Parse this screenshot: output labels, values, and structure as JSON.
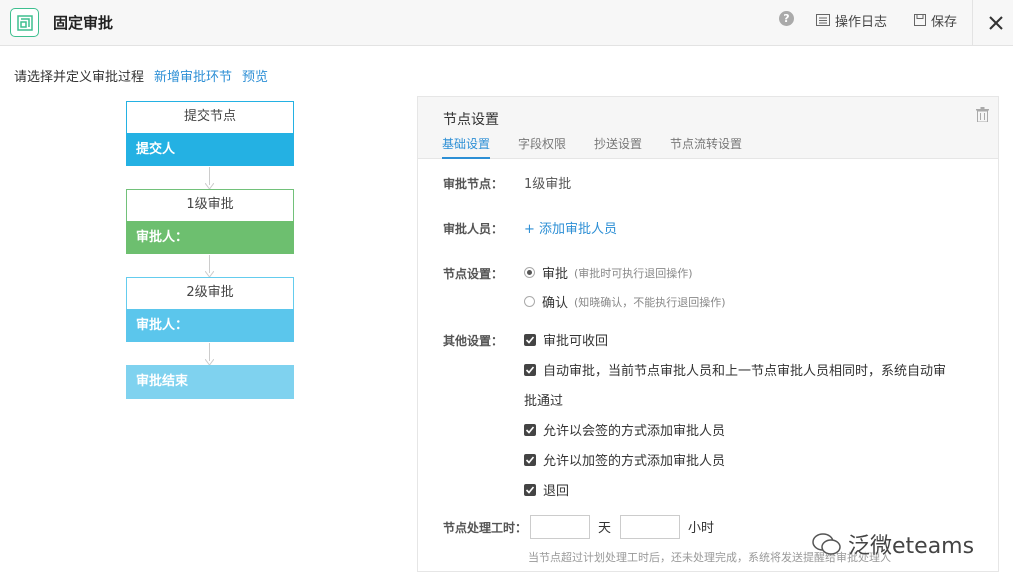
{
  "header": {
    "title": "固定审批",
    "help_label": "?",
    "log_label": "操作日志",
    "save_label": "保存"
  },
  "toolbar": {
    "prompt": "请选择并定义审批过程",
    "add_step": "新增审批环节",
    "preview": "预览"
  },
  "flow": {
    "nodes": [
      {
        "title": "提交节点",
        "body": "提交人",
        "color": "#24b1e3"
      },
      {
        "title": "1级审批",
        "body": "审批人：",
        "color": "#6dbf6f"
      },
      {
        "title": "2级审批",
        "body": "审批人：",
        "color": "#5bc6ec"
      }
    ],
    "end_label": "审批结束",
    "end_color": "#7fd2ef"
  },
  "panel": {
    "title": "节点设置",
    "tabs": [
      {
        "label": "基础设置",
        "active": true
      },
      {
        "label": "字段权限",
        "active": false
      },
      {
        "label": "抄送设置",
        "active": false
      },
      {
        "label": "节点流转设置",
        "active": false
      }
    ],
    "approval_node_label": "审批节点：",
    "approval_node_value": "1级审批",
    "approver_label": "审批人员：",
    "add_approver": "+ 添加审批人员",
    "node_setting_label": "节点设置：",
    "radio_options": [
      {
        "label": "审批",
        "hint": "(审批时可执行退回操作)",
        "selected": true
      },
      {
        "label": "确认",
        "hint": "(知晓确认，不能执行退回操作)",
        "selected": false
      }
    ],
    "other_label": "其他设置：",
    "checkboxes": [
      {
        "label": "审批可收回",
        "checked": true
      },
      {
        "label": "自动审批，当前节点审批人员和上一节点审批人员相同时，系统自动审",
        "checked": true
      },
      {
        "label": "允许以会签的方式添加审批人员",
        "checked": true
      },
      {
        "label": "允许以加签的方式添加审批人员",
        "checked": true
      },
      {
        "label": "退回",
        "checked": true
      }
    ],
    "auto_approve_cont": "批通过",
    "time_label": "节点处理工时：",
    "day_unit": "天",
    "hour_unit": "小时",
    "time_hint": "当节点超过计划处理工时后，还未处理完成，系统将发送提醒给审批处理人"
  },
  "watermark": "泛微eteams",
  "accent_color": "#2d8fd5"
}
